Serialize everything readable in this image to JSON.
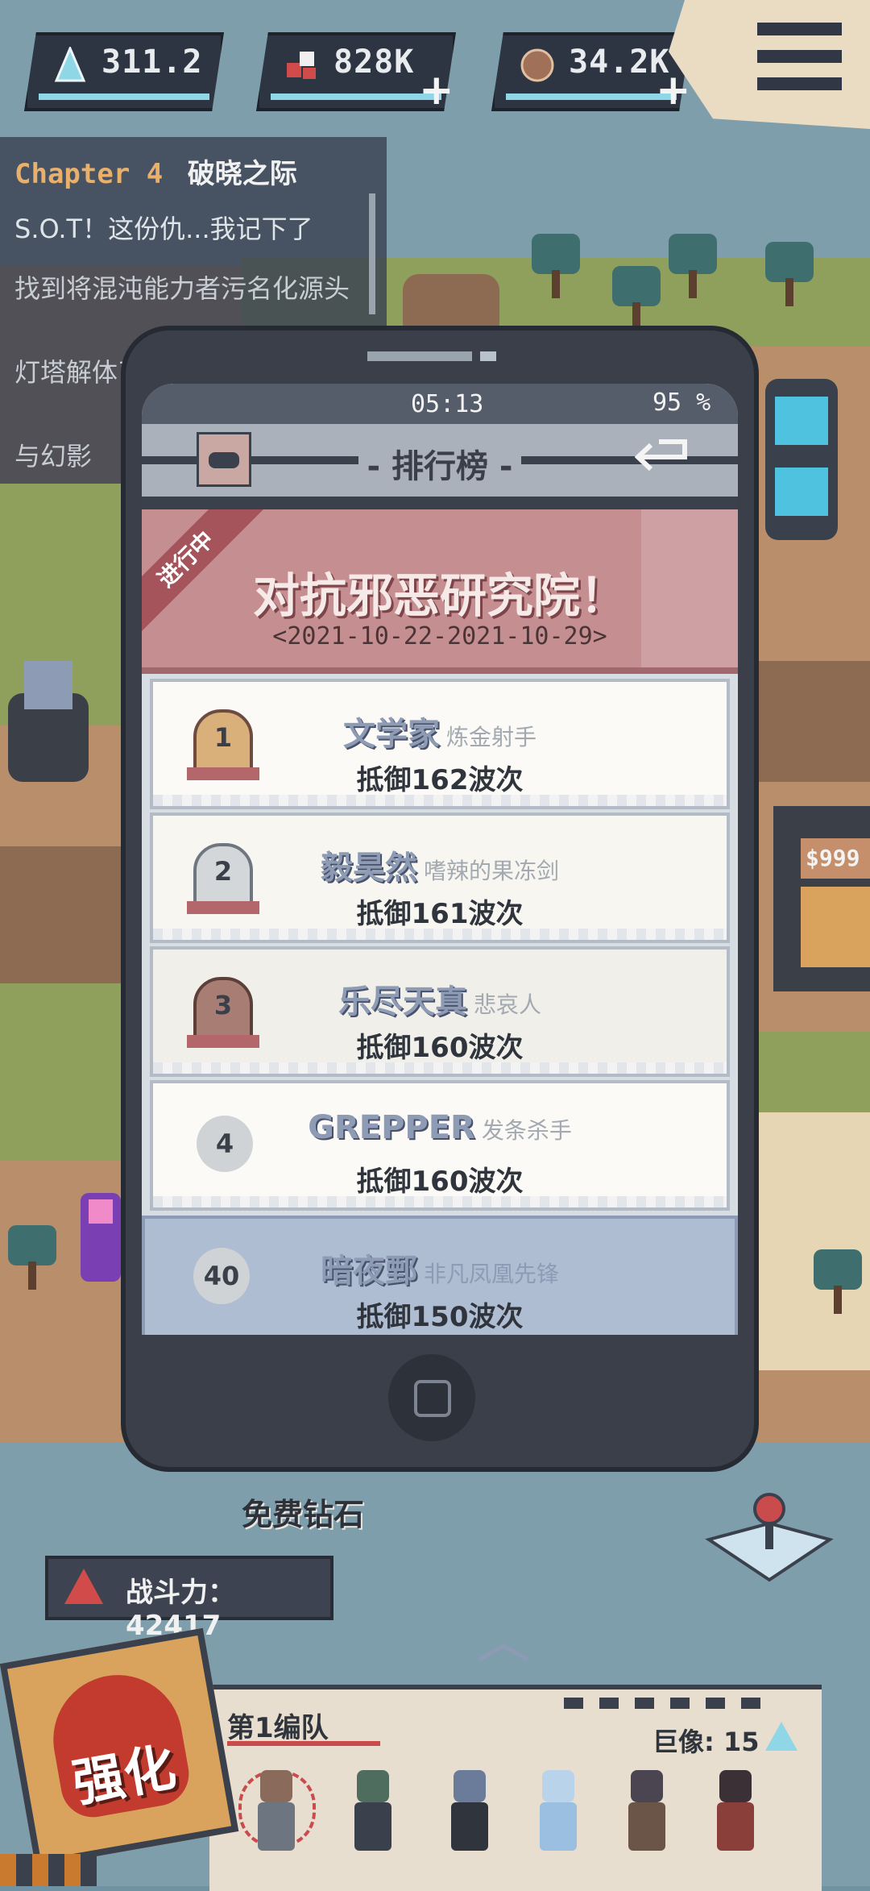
{
  "resources": [
    {
      "icon": "crystal-icon",
      "value": "311.2",
      "has_plus": false
    },
    {
      "icon": "gem-pile-icon",
      "value": "828K",
      "has_plus": true
    },
    {
      "icon": "ore-icon",
      "value": "34.2K",
      "has_plus": true
    }
  ],
  "quest": {
    "chapter": "Chapter 4",
    "chapter_name": "破晓之际",
    "items": [
      "S.O.T！这份仇...我记下了",
      "找到将混沌能力者污名化源头",
      "灯塔解体了！",
      "与幻影"
    ]
  },
  "phone": {
    "time": "05:13",
    "battery": "95 %",
    "title": "- 排行榜 -",
    "event": {
      "tag": "进行中",
      "title": "对抗邪恶研究院！",
      "dates": "<2021-10-22-2021-10-29>"
    },
    "rankings": [
      {
        "rank": "1",
        "name": "文学家",
        "title": "炼金射手",
        "score": "抵御162波次"
      },
      {
        "rank": "2",
        "name": "毅昊然",
        "title": "嗜辣的果冻剑",
        "score": "抵御161波次"
      },
      {
        "rank": "3",
        "name": "乐尽天真",
        "title": "悲哀人",
        "score": "抵御160波次"
      },
      {
        "rank": "4",
        "name": "GREPPER",
        "title": "发条杀手",
        "score": "抵御160波次"
      }
    ],
    "my_rank": {
      "rank": "40",
      "name": "暗夜鄄",
      "title": "非凡凤凰先锋",
      "score": "抵御150波次"
    }
  },
  "free_gems": "免费钻石",
  "power": {
    "label": "战斗力：42417"
  },
  "team": {
    "name": "第1编队",
    "giant_label": "巨像: 15"
  },
  "upgrade_label": "强化",
  "colors": {
    "accent_red": "#c94b4b",
    "crystal": "#8fd6e6",
    "banner": "#c58f92"
  }
}
